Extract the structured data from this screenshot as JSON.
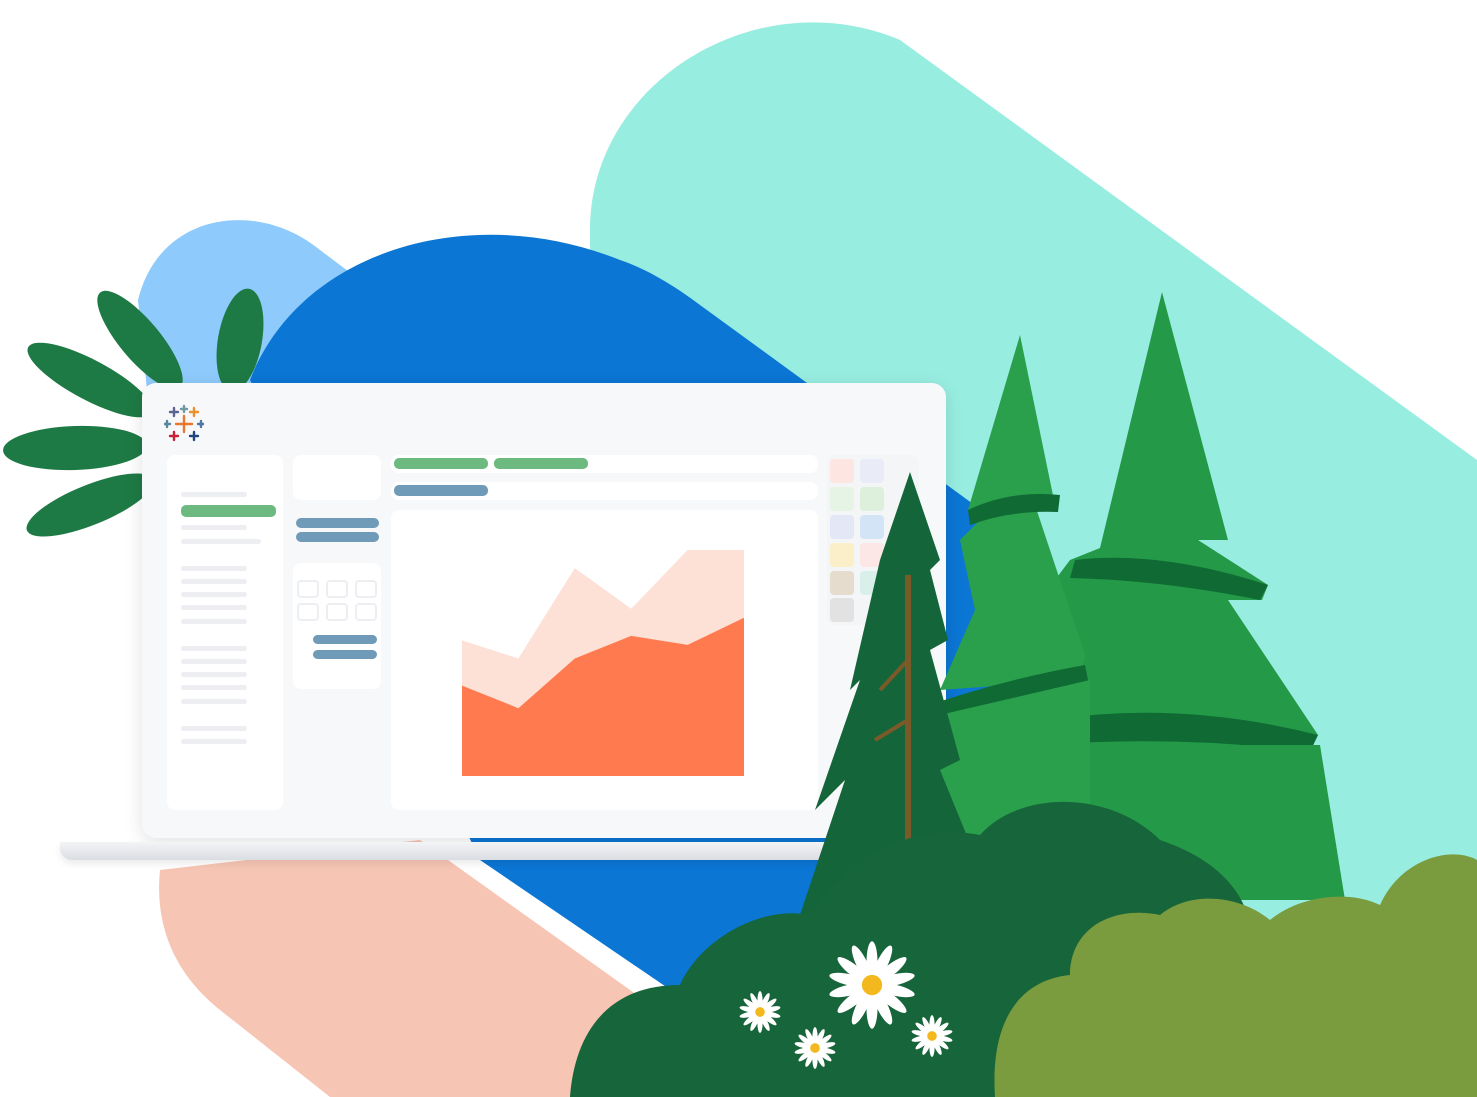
{
  "colors": {
    "teal_shape": "#98ede1",
    "light_blue_shape": "#8ecbfc",
    "blue_shape": "#0b76d4",
    "peach_shape": "#f7c5b4",
    "leaf_green": "#1e7a45",
    "tree_green": "#249a48",
    "tree_dark": "#0f6a34",
    "bush_dark": "#17653a",
    "bush_olive": "#7a9b3e",
    "area_front": "#ff7a4e",
    "area_back": "#fde0d6",
    "ui_green": "#6cba7f",
    "ui_steel": "#6f9ab8"
  },
  "icons": [
    "tableau-logo-icon",
    "area-chart-icon",
    "daisy-flower-icon",
    "pine-tree-icon",
    "leaf-plant-icon"
  ],
  "chart_data": {
    "type": "area",
    "x": [
      0,
      1,
      2,
      3,
      4,
      5
    ],
    "series": [
      {
        "values": [
          40,
          30,
          52,
          62,
          58,
          70
        ]
      },
      {
        "values": [
          60,
          52,
          92,
          74,
          100,
          100
        ]
      }
    ],
    "ylim": [
      0,
      100
    ],
    "grid": false
  }
}
